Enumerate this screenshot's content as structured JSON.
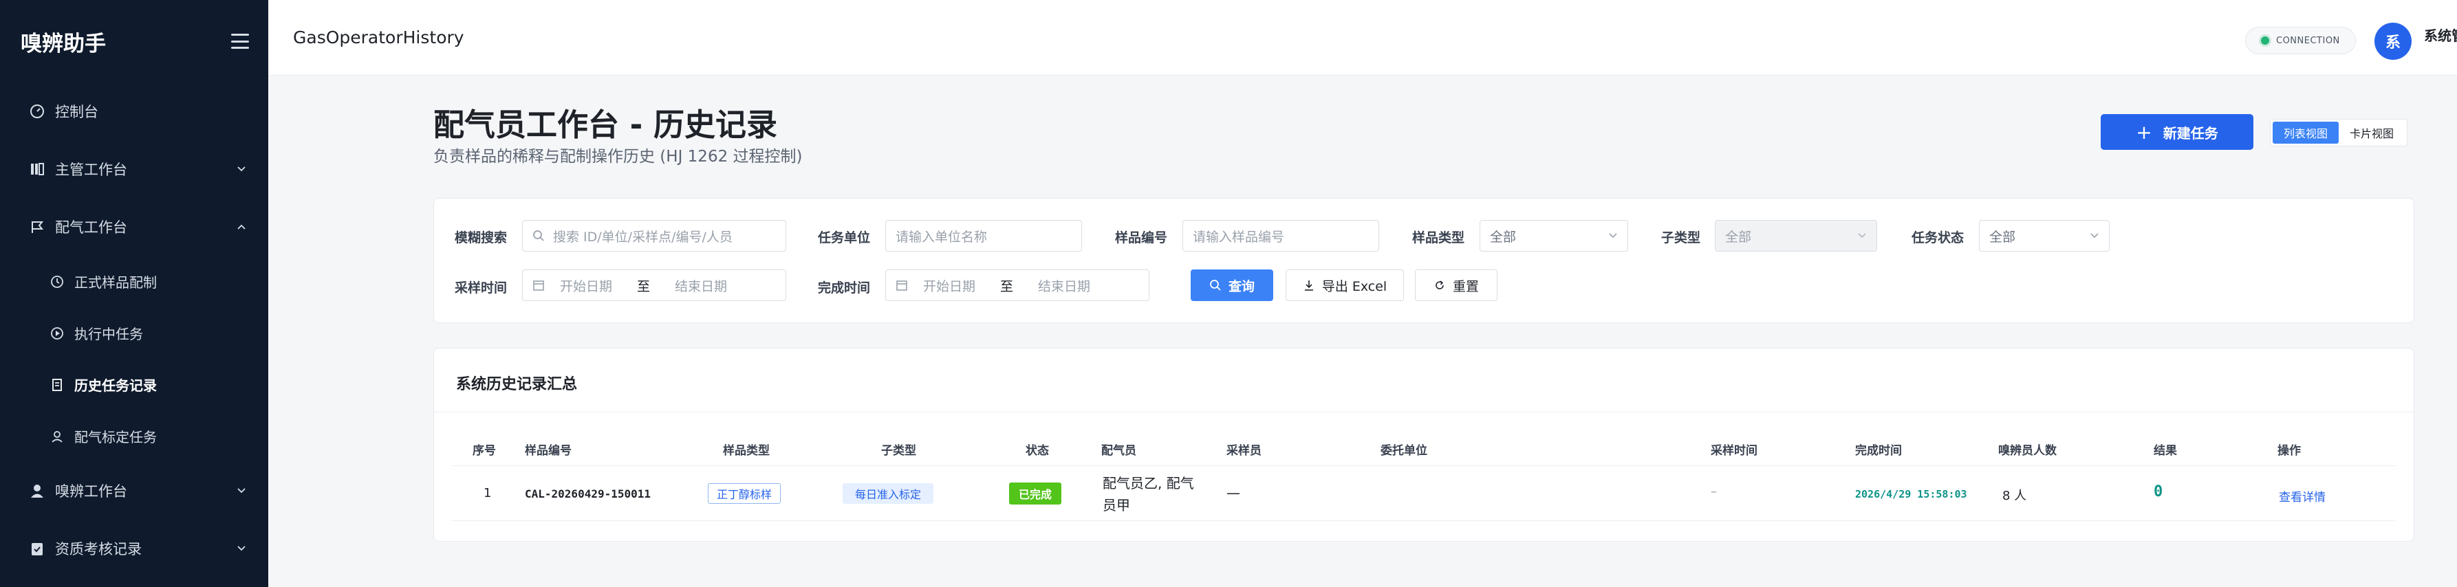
{
  "sidebar": {
    "brand": "嗅辨助手",
    "items": [
      {
        "label": "控制台"
      },
      {
        "label": "主管工作台"
      },
      {
        "label": "配气工作台"
      },
      {
        "label": "嗅辨工作台"
      },
      {
        "label": "资质考核记录"
      }
    ],
    "subitems": [
      {
        "label": "正式样品配制"
      },
      {
        "label": "执行中任务"
      },
      {
        "label": "历史任务记录"
      },
      {
        "label": "配气标定任务"
      }
    ]
  },
  "topbar": {
    "title": "GasOperatorHistory",
    "connection": "CONNECTION",
    "avatar_initial": "系",
    "user_name": "系统管理员"
  },
  "header": {
    "title": "配气员工作台 - 历史记录",
    "subtitle": "负责样品的稀释与配制操作历史 (HJ 1262 过程控制)",
    "new_task": "新建任务",
    "new_task_plus": "+",
    "view_list": "列表视图",
    "view_card": "卡片视图"
  },
  "filters": {
    "fuzzy_label": "模糊搜索",
    "fuzzy_placeholder": "搜索 ID/单位/采样点/编号/人员",
    "unit_label": "任务单位",
    "unit_placeholder": "请输入单位名称",
    "sample_no_label": "样品编号",
    "sample_no_placeholder": "请输入样品编号",
    "sample_type_label": "样品类型",
    "sample_type_value": "全部",
    "subtype_label": "子类型",
    "subtype_value": "全部",
    "status_label": "任务状态",
    "status_value": "全部",
    "sampling_time_label": "采样时间",
    "finish_time_label": "完成时间",
    "start_placeholder": "开始日期",
    "end_placeholder": "结束日期",
    "range_sep": "至",
    "query": "查询",
    "export": "导出 Excel",
    "reset": "重置"
  },
  "summary": {
    "title": "系统历史记录汇总",
    "columns": [
      "序号",
      "样品编号",
      "样品类型",
      "子类型",
      "状态",
      "配气员",
      "采样员",
      "委托单位",
      "采样时间",
      "完成时间",
      "嗅辨员人数",
      "结果",
      "操作"
    ],
    "rows": [
      {
        "index": "1",
        "sample_no": "CAL-20260429-150011",
        "sample_type": "正丁醇标样",
        "subtype": "每日准入标定",
        "status": "已完成",
        "gas_operator_line1": "配气员乙, 配气",
        "gas_operator_line2": "员甲",
        "sampler": "—",
        "client": "",
        "sampling_time": "–",
        "finish_time": "2026/4/29 15:58:03",
        "panelists": "8 人",
        "result": "0",
        "action": "查看详情"
      }
    ]
  },
  "colors": {
    "sidebar_bg": "#0f1b2d",
    "primary": "#2563eb",
    "success": "#52c41a"
  }
}
